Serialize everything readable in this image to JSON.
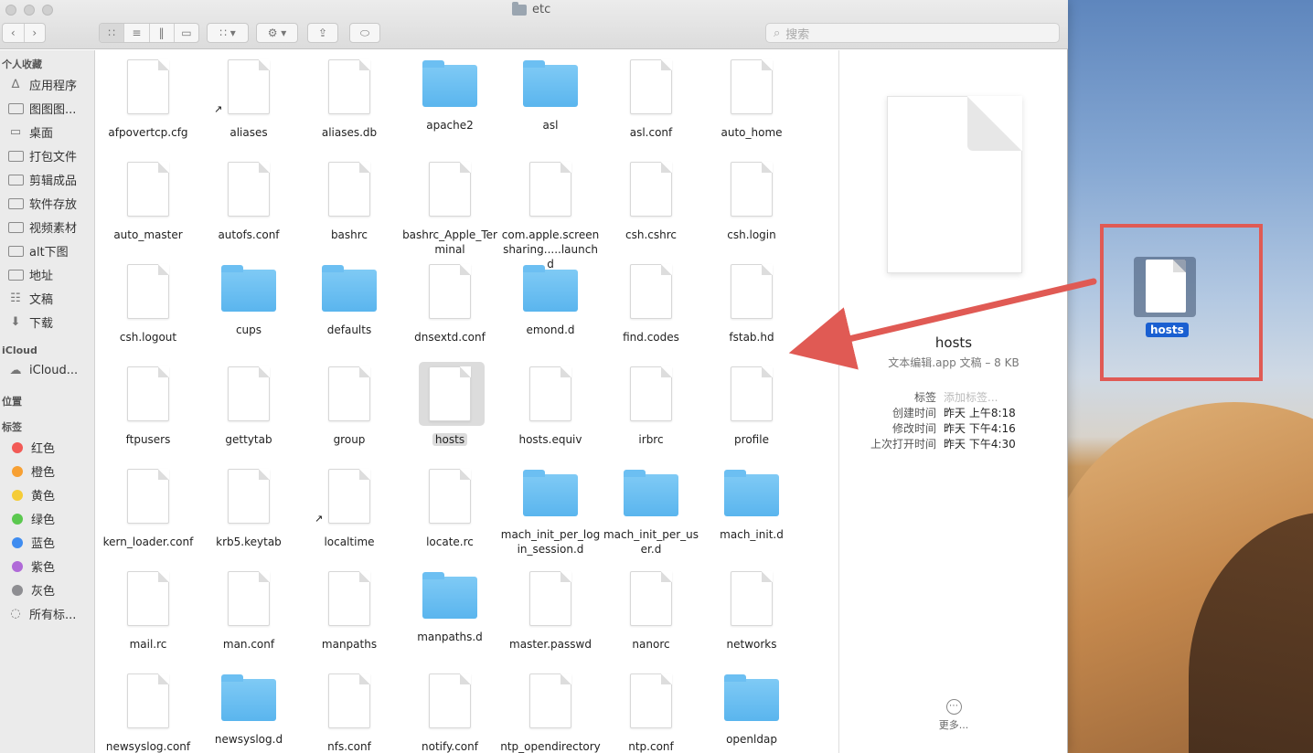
{
  "window": {
    "title": "etc"
  },
  "toolbar": {
    "back_icon": "chevron-left-icon",
    "forward_icon": "chevron-right-icon",
    "search_placeholder": "搜索"
  },
  "sidebar": {
    "favorites_header": "个人收藏",
    "favorites": [
      {
        "label": "应用程序",
        "icon": "applications-icon"
      },
      {
        "label": "图图图...",
        "icon": "folder-icon"
      },
      {
        "label": "桌面",
        "icon": "desktop-icon"
      },
      {
        "label": "打包文件",
        "icon": "folder-icon"
      },
      {
        "label": "剪辑成品",
        "icon": "folder-icon"
      },
      {
        "label": "软件存放",
        "icon": "folder-icon"
      },
      {
        "label": "视频素材",
        "icon": "folder-icon"
      },
      {
        "label": "alt下图",
        "icon": "folder-icon"
      },
      {
        "label": "地址",
        "icon": "folder-icon"
      },
      {
        "label": "文稿",
        "icon": "documents-icon"
      },
      {
        "label": "下载",
        "icon": "downloads-icon"
      }
    ],
    "icloud_header": "iCloud",
    "icloud_item": "iCloud...",
    "locations_header": "位置",
    "tags_header": "标签",
    "tags": [
      {
        "label": "红色",
        "color": "#f25a56"
      },
      {
        "label": "橙色",
        "color": "#f7a033"
      },
      {
        "label": "黄色",
        "color": "#f5cc37"
      },
      {
        "label": "绿色",
        "color": "#5bc84f"
      },
      {
        "label": "蓝色",
        "color": "#3f8cf0"
      },
      {
        "label": "紫色",
        "color": "#b06ad8"
      },
      {
        "label": "灰色",
        "color": "#8e8e92"
      }
    ],
    "all_tags": "所有标..."
  },
  "files": [
    {
      "name": "afpovertcp.cfg",
      "type": "doc"
    },
    {
      "name": "aliases",
      "type": "alias"
    },
    {
      "name": "aliases.db",
      "type": "doc"
    },
    {
      "name": "apache2",
      "type": "folder"
    },
    {
      "name": "asl",
      "type": "folder"
    },
    {
      "name": "asl.conf",
      "type": "doc"
    },
    {
      "name": "auto_home",
      "type": "doc"
    },
    {
      "name": "auto_master",
      "type": "doc"
    },
    {
      "name": "autofs.conf",
      "type": "doc"
    },
    {
      "name": "bashrc",
      "type": "doc"
    },
    {
      "name": "bashrc_Apple_Terminal",
      "type": "doc"
    },
    {
      "name": "com.apple.screensharing.....launchd",
      "type": "doc"
    },
    {
      "name": "csh.cshrc",
      "type": "doc"
    },
    {
      "name": "csh.login",
      "type": "doc"
    },
    {
      "name": "csh.logout",
      "type": "doc"
    },
    {
      "name": "cups",
      "type": "folder"
    },
    {
      "name": "defaults",
      "type": "folder"
    },
    {
      "name": "dnsextd.conf",
      "type": "doc"
    },
    {
      "name": "emond.d",
      "type": "folder"
    },
    {
      "name": "find.codes",
      "type": "doc"
    },
    {
      "name": "fstab.hd",
      "type": "doc"
    },
    {
      "name": "ftpusers",
      "type": "doc"
    },
    {
      "name": "gettytab",
      "type": "doc"
    },
    {
      "name": "group",
      "type": "doc"
    },
    {
      "name": "hosts",
      "type": "doc",
      "selected": true
    },
    {
      "name": "hosts.equiv",
      "type": "doc"
    },
    {
      "name": "irbrc",
      "type": "doc"
    },
    {
      "name": "profile",
      "type": "doc"
    },
    {
      "name": "kern_loader.conf",
      "type": "doc"
    },
    {
      "name": "krb5.keytab",
      "type": "doc"
    },
    {
      "name": "localtime",
      "type": "alias"
    },
    {
      "name": "locate.rc",
      "type": "doc"
    },
    {
      "name": "mach_init_per_login_session.d",
      "type": "folder"
    },
    {
      "name": "mach_init_per_user.d",
      "type": "folder"
    },
    {
      "name": "mach_init.d",
      "type": "folder"
    },
    {
      "name": "mail.rc",
      "type": "doc"
    },
    {
      "name": "man.conf",
      "type": "doc"
    },
    {
      "name": "manpaths",
      "type": "doc"
    },
    {
      "name": "manpaths.d",
      "type": "folder"
    },
    {
      "name": "master.passwd",
      "type": "doc"
    },
    {
      "name": "nanorc",
      "type": "doc"
    },
    {
      "name": "networks",
      "type": "doc"
    },
    {
      "name": "newsyslog.conf",
      "type": "doc"
    },
    {
      "name": "newsyslog.d",
      "type": "folder"
    },
    {
      "name": "nfs.conf",
      "type": "doc"
    },
    {
      "name": "notify.conf",
      "type": "doc"
    },
    {
      "name": "ntp_opendirectory",
      "type": "doc"
    },
    {
      "name": "ntp.conf",
      "type": "doc"
    },
    {
      "name": "openldap",
      "type": "folder"
    }
  ],
  "preview": {
    "name": "hosts",
    "subtitle": "文本编辑.app 文稿 – 8 KB",
    "tags_key": "标签",
    "tags_placeholder": "添加标签...",
    "created_key": "创建时间",
    "created_val": "昨天 上午8:18",
    "modified_key": "修改时间",
    "modified_val": "昨天 下午4:16",
    "opened_key": "上次打开时间",
    "opened_val": "昨天 下午4:30",
    "more_label": "更多..."
  },
  "desktop": {
    "icon_label": "hosts",
    "highlight_color": "#e05a54"
  }
}
